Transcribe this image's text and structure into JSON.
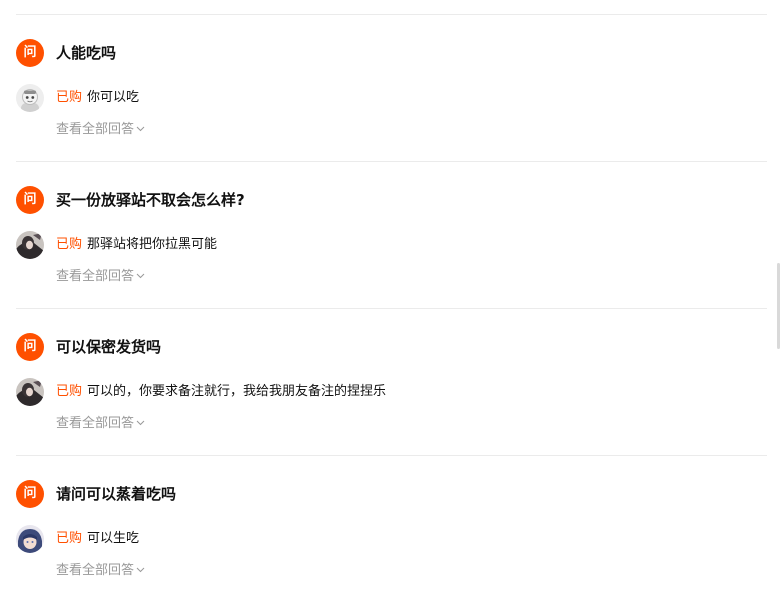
{
  "questions": [
    {
      "badge": "问",
      "title": "人能吃吗",
      "avatar_icon": "robot-avatar-icon",
      "bought_tag": "已购",
      "answer": "你可以吃",
      "view_all": "查看全部回答"
    },
    {
      "badge": "问",
      "title": "买一份放驿站不取会怎么样?",
      "avatar_icon": "person-dark-avatar-icon",
      "bought_tag": "已购",
      "answer": "那驿站将把你拉黑可能",
      "view_all": "查看全部回答"
    },
    {
      "badge": "问",
      "title": "可以保密发货吗",
      "avatar_icon": "person-dark-avatar-icon",
      "bought_tag": "已购",
      "answer": "可以的，你要求备注就行，我给我朋友备注的捏捏乐",
      "view_all": "查看全部回答"
    },
    {
      "badge": "问",
      "title": "请问可以蒸着吃吗",
      "avatar_icon": "anime-blue-avatar-icon",
      "bought_tag": "已购",
      "answer": "可以生吃",
      "view_all": "查看全部回答"
    }
  ],
  "colors": {
    "accent": "#ff5000",
    "text": "#111111",
    "muted": "#999999",
    "divider": "#ebebeb"
  }
}
